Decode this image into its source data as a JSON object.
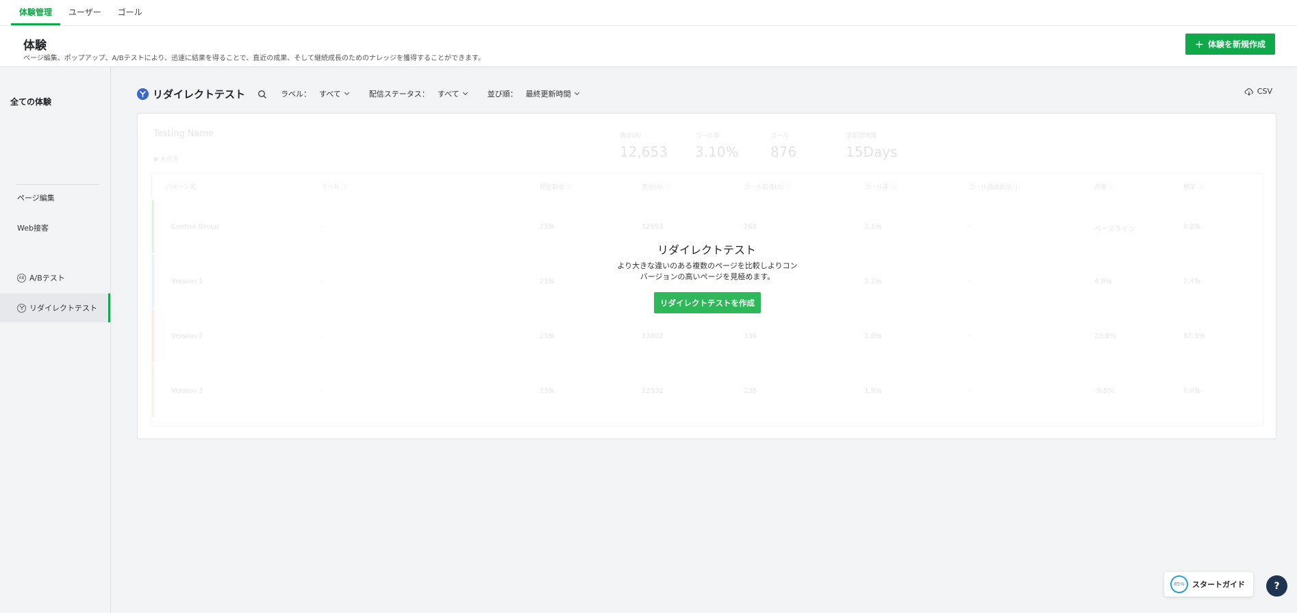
{
  "topnav": {
    "tabs": [
      {
        "label": "体験管理",
        "active": true
      },
      {
        "label": "ユーザー",
        "active": false
      },
      {
        "label": "ゴール",
        "active": false
      }
    ]
  },
  "header": {
    "title": "体験",
    "description": "ページ編集、ポップアップ、A/Bテストにより、迅速に結果を得ることで、直近の成果、そして継続成長のためのナレッジを獲得することができます。",
    "new_button": "体験を新規作成"
  },
  "sidebar": {
    "section_title": "全ての体験",
    "items": [
      {
        "label": "ページ編集",
        "icon": "none"
      },
      {
        "label": "Web接客",
        "icon": "none"
      },
      {
        "label": "A/Bテスト",
        "icon": "ab-icon"
      },
      {
        "label": "リダイレクトテスト",
        "icon": "redirect-icon",
        "active": true
      }
    ]
  },
  "filterbar": {
    "title": "リダイレクトテスト",
    "label_filter": {
      "label": "ラベル：",
      "value": "すべて"
    },
    "status_filter": {
      "label": "配信ステータス：",
      "value": "すべて"
    },
    "sort": {
      "label": "並び順：",
      "value": "最終更新時間"
    },
    "csv": "CSV"
  },
  "ghost": {
    "name": "Testing Name",
    "tag": "▼ 未設定",
    "stats": [
      {
        "label": "表示UU",
        "value": "12,653"
      },
      {
        "label": "ゴール率",
        "value": "3.10%"
      },
      {
        "label": "ゴール",
        "value": "876"
      },
      {
        "label": "全配信時間",
        "value": "15Days"
      }
    ],
    "columns": [
      "パターン名",
      "ラベル ⓘ",
      "配信割合 ⓘ",
      "表示UU ⓘ",
      "ゴール到達UU ⓘ",
      "ゴール率 ⓘ",
      "ゴール通過状況 ⓘ",
      "改善 ⓘ",
      "勝率 ⓘ"
    ],
    "rows": [
      [
        "Control Group",
        "-",
        "25%",
        "12653",
        "268",
        "2.1%",
        "-",
        "ベースライン",
        "0.2%"
      ],
      [
        "Version 1",
        "-",
        "25%",
        "",
        "",
        "2.2%",
        "-",
        "4.9%",
        "2.4%"
      ],
      [
        "Version 2",
        "-",
        "25%",
        "12802",
        "336",
        "2.6%",
        "-",
        "23.8%",
        "97.3%"
      ],
      [
        "Version 3",
        "-",
        "25%",
        "12532",
        "238",
        "1.9%",
        "-",
        "-9.5%",
        "0.0%"
      ]
    ],
    "row_colors": [
      "#2a9d4a",
      "#2fb8a0",
      "#e8643c",
      "#8bc34a"
    ]
  },
  "empty_state": {
    "title": "リダイレクトテスト",
    "description": "より大きな違いのある複数のページを比較しよりコンバージョンの高いページを見極めます。",
    "button": "リダイレクトテストを作成"
  },
  "guide": {
    "progress": "85%",
    "label": "スタートガイド"
  },
  "help": {
    "label": "?"
  },
  "colors": {
    "accent": "#10a94a",
    "brand_blue": "#3868c9",
    "help_bg": "#1f3450"
  }
}
